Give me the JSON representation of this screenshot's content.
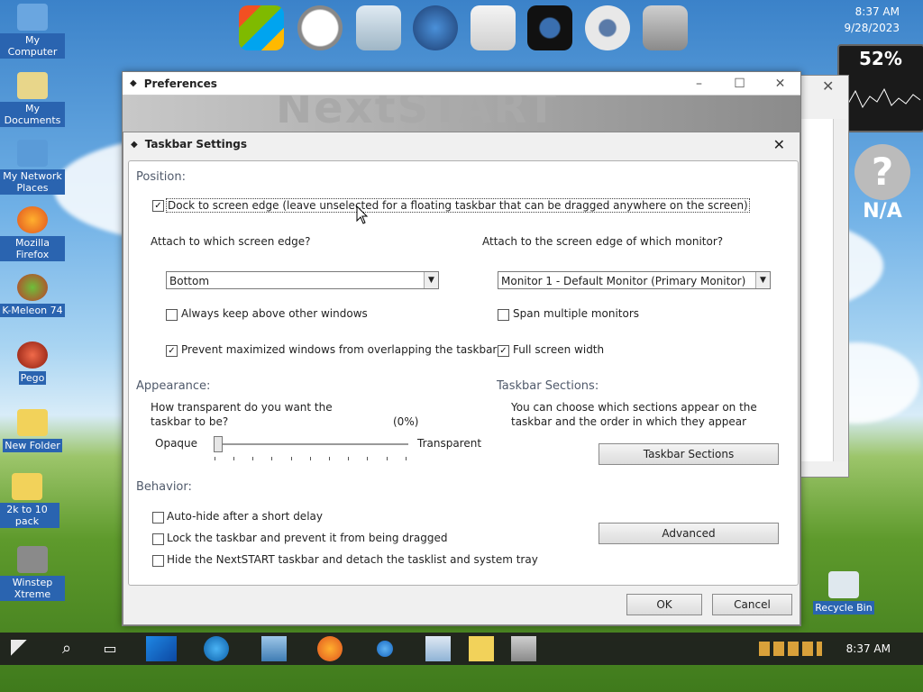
{
  "desktop": {
    "icons": [
      {
        "label": "My Computer"
      },
      {
        "label": "My Documents"
      },
      {
        "label": "My Network Places"
      },
      {
        "label": "Mozilla Firefox"
      },
      {
        "label": "K-Meleon 74"
      },
      {
        "label": "Pego"
      },
      {
        "label": "New Folder"
      },
      {
        "label": "2k to 10 pack"
      },
      {
        "label": "Winstep Xtreme"
      },
      {
        "label": "Recycle Bin"
      }
    ],
    "clock_time": "8:37 AM",
    "clock_date": "9/28/2023",
    "cpu_percent": "52%",
    "weather_text": "N/A"
  },
  "dock": {
    "icons": [
      "windows-logo-icon",
      "clock-icon",
      "recycle-bin-icon",
      "globe-icon",
      "mail-icon",
      "camera-icon",
      "disk-icon",
      "control-panel-icon"
    ]
  },
  "preferences_window": {
    "title": "Preferences"
  },
  "dialog": {
    "title": "Taskbar Settings",
    "position": {
      "heading": "Position:",
      "dock_label": "Dock to screen edge (leave unselected for a floating taskbar that can be dragged anywhere on the screen)",
      "dock_checked": true,
      "attach_edge_label": "Attach to which screen edge?",
      "attach_edge_value": "Bottom",
      "attach_monitor_label": "Attach to the screen edge of which monitor?",
      "attach_monitor_value": "Monitor 1 - Default Monitor (Primary Monitor)",
      "always_above_label": "Always keep above other windows",
      "always_above_checked": false,
      "span_label": "Span multiple monitors",
      "span_checked": false,
      "prevent_overlap_label": "Prevent maximized windows from overlapping the taskbar",
      "prevent_overlap_checked": true,
      "full_width_label": "Full screen width",
      "full_width_checked": true
    },
    "appearance": {
      "heading": "Appearance:",
      "question_line1": "How transparent do you want the",
      "question_line2": "taskbar to be?",
      "value_label": "(0%)",
      "value": 0,
      "opaque_label": "Opaque",
      "transparent_label": "Transparent"
    },
    "sections": {
      "heading": "Taskbar Sections:",
      "desc_line1": "You can choose which sections appear on the",
      "desc_line2": "taskbar and the order in which they appear",
      "button": "Taskbar Sections"
    },
    "behavior": {
      "heading": "Behavior:",
      "autohide_label": "Auto-hide after a short delay",
      "autohide_checked": false,
      "lock_label": "Lock the taskbar and prevent it from being dragged",
      "lock_checked": false,
      "hide_label": "Hide the NextSTART taskbar and detach the tasklist and system tray",
      "hide_checked": false,
      "advanced_button": "Advanced"
    },
    "ok_button": "OK",
    "cancel_button": "Cancel"
  },
  "taskbar": {
    "time": "8:37 AM"
  },
  "colors": {
    "section_heading": "#505a6b",
    "taskbar": "#1e1e1e",
    "desktop_label_bg": "#2a64b0"
  }
}
